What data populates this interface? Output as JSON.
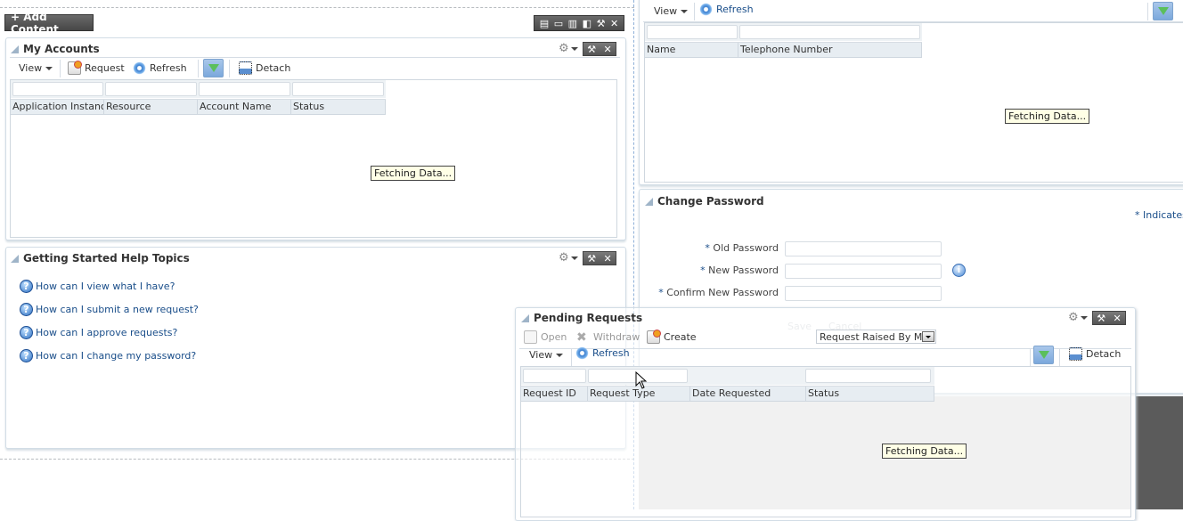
{
  "toolbar": {
    "add_content_label": "+ Add Content",
    "layout_icons": [
      "layout-one-column-icon",
      "layout-two-row-icon",
      "layout-two-column-icon",
      "layout-narrow-wide-icon",
      "wrench-icon",
      "close-icon"
    ]
  },
  "my_accounts": {
    "title": "My Accounts",
    "view_label": "View",
    "request_label": "Request",
    "refresh_label": "Refresh",
    "detach_label": "Detach",
    "columns": [
      "Application Instance",
      "Resource",
      "Account Name",
      "Status"
    ],
    "status_text": "Fetching Data..."
  },
  "help_topics": {
    "title": "Getting Started Help Topics",
    "links": [
      "How can I view what I have?",
      "How can I submit a new request?",
      "How can I approve requests?",
      "How can I change my password?"
    ]
  },
  "contacts": {
    "view_label": "View",
    "refresh_label": "Refresh",
    "columns": [
      "Name",
      "Telephone Number"
    ],
    "status_text": "Fetching Data..."
  },
  "change_password": {
    "title": "Change Password",
    "required_note": "* Indicates",
    "fields": [
      {
        "label": "Old Password",
        "value": ""
      },
      {
        "label": "New Password",
        "value": ""
      },
      {
        "label": "Confirm New Password",
        "value": ""
      }
    ],
    "required_marker": "*",
    "save_label": "Save",
    "cancel_label": "Cancel"
  },
  "pending_requests": {
    "title": "Pending Requests",
    "open_label": "Open",
    "withdraw_label": "Withdraw",
    "create_label": "Create",
    "filter_select_value": "Request Raised By Me",
    "view_label": "View",
    "refresh_label": "Refresh",
    "detach_label": "Detach",
    "columns": [
      "Request ID",
      "Request Type",
      "Date Requested",
      "Status"
    ],
    "status_text": "Fetching Data..."
  },
  "icons": {
    "gear": "⚙",
    "wrench": "⚒",
    "close": "✕",
    "help": "?",
    "info": "i"
  }
}
